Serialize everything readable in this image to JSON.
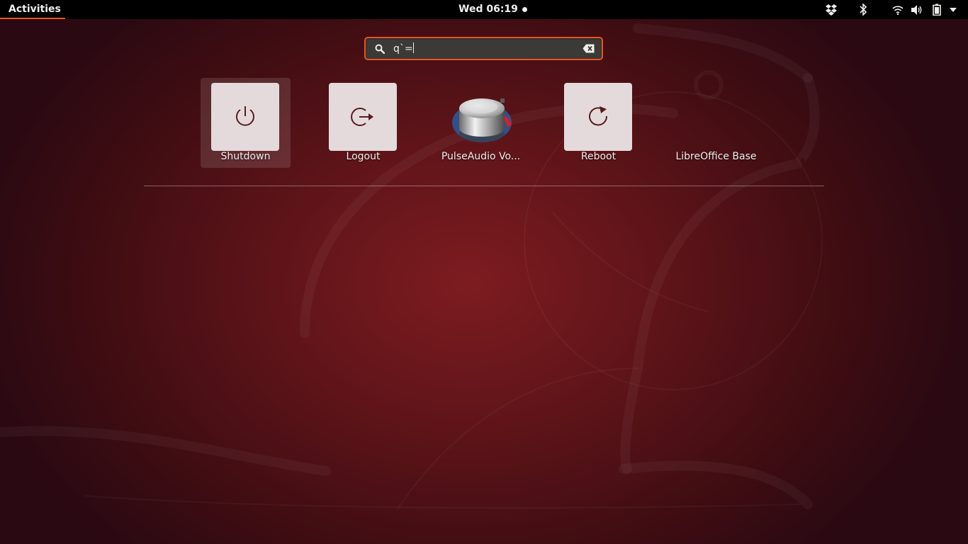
{
  "topbar": {
    "activities_label": "Activities",
    "clock": "Wed 06:19",
    "tray_icons": [
      "dropbox-icon",
      "bluetooth-icon",
      "wifi-icon",
      "volume-icon",
      "battery-icon",
      "system-menu-arrow-icon"
    ]
  },
  "search": {
    "value": "q`="
  },
  "results": [
    {
      "label": "Shutdown",
      "icon": "power-icon",
      "selected": true
    },
    {
      "label": "Logout",
      "icon": "logout-icon",
      "selected": false
    },
    {
      "label": "PulseAudio Vo...",
      "icon": "volume-knob-icon",
      "selected": false
    },
    {
      "label": "Reboot",
      "icon": "reboot-icon",
      "selected": false
    },
    {
      "label": "LibreOffice Base",
      "icon": "none",
      "selected": false
    }
  ],
  "colors": {
    "accent": "#e95420",
    "topbar_bg": "#000000",
    "tile_bg": "#e4dadb",
    "glyph": "#5a1a1e"
  }
}
